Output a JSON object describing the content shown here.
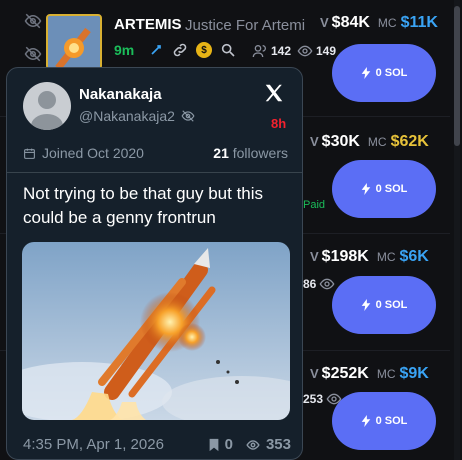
{
  "rows": [
    {
      "name": "ARTEMIS",
      "full_name": "Justice For Artemi",
      "age": "9m",
      "holders": "142",
      "views": "149",
      "volume": "$84K",
      "market_cap": "$11K",
      "mc_color": "#3aa4f5",
      "buy_label": "0 SOL"
    },
    {
      "volume": "$30K",
      "market_cap": "$62K",
      "mc_color": "#e8c33a",
      "badge": "Paid",
      "buy_label": "0 SOL"
    },
    {
      "volume": "$198K",
      "market_cap": "$6K",
      "mc_color": "#3aa4f5",
      "partial_stat": "86",
      "buy_label": "0 SOL"
    },
    {
      "volume": "$252K",
      "market_cap": "$9K",
      "mc_color": "#3aa4f5",
      "partial_stat": "253",
      "buy_label": "0 SOL"
    }
  ],
  "labels": {
    "volume_prefix": "V",
    "mc_prefix": "MC"
  },
  "tweet": {
    "author_name": "Nakanakaja",
    "handle": "@Nakanakaja2",
    "time_ago": "8h",
    "joined": "Joined Oct 2020",
    "followers_count": "21",
    "followers_label": "followers",
    "text": "Not trying to be that guy but this could be a genny frontrun",
    "timestamp": "4:35 PM, Apr 1, 2026",
    "bookmarks": "0",
    "views": "353"
  },
  "icons": [
    "eye-off-icon",
    "pump-icon",
    "link-icon",
    "coin-icon",
    "search-icon",
    "users-icon",
    "eye-icon",
    "lightning-icon",
    "x-logo-icon",
    "calendar-icon",
    "bookmark-icon"
  ]
}
